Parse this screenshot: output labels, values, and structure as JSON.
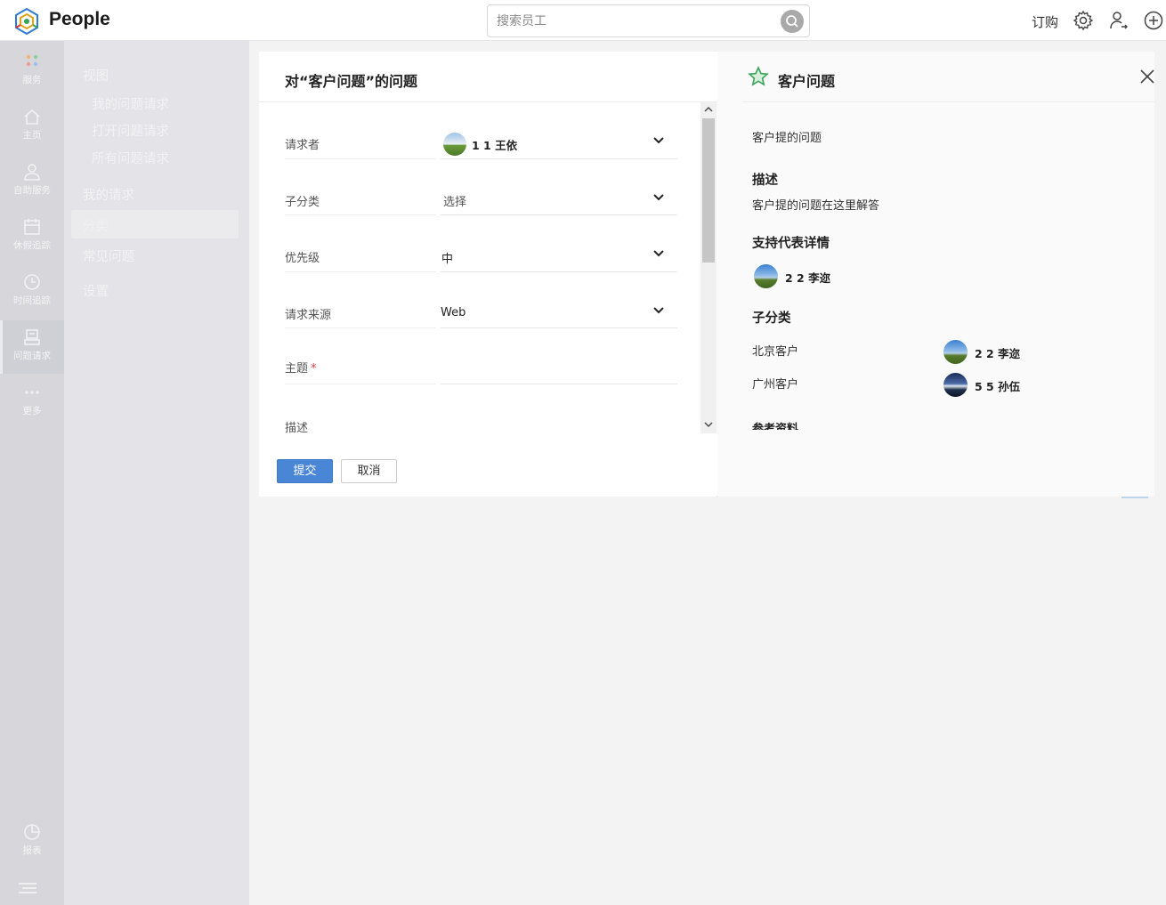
{
  "app": {
    "name": "People"
  },
  "search": {
    "placeholder": "搜索员工"
  },
  "topbar": {
    "subscribe": "订购"
  },
  "rail": {
    "items": [
      {
        "label": "服务",
        "icon": "services-dots-icon"
      },
      {
        "label": "主页",
        "icon": "home-icon"
      },
      {
        "label": "自助服务",
        "icon": "user-icon"
      },
      {
        "label": "休假追踪",
        "icon": "calendar-icon"
      },
      {
        "label": "时间追踪",
        "icon": "clock-icon"
      },
      {
        "label": "问题请求",
        "icon": "ticket-icon",
        "active": true
      },
      {
        "label": "更多",
        "icon": "more-dots-icon"
      },
      {
        "label": "报表",
        "icon": "pie-chart-icon"
      }
    ]
  },
  "subnav": {
    "view": "视图",
    "my_requests_issue": "我的问题请求",
    "open_requests": "打开问题请求",
    "all_requests": "所有问题请求",
    "my_requests": "我的请求",
    "category": "分类",
    "faq": "常见问题",
    "settings": "设置"
  },
  "form": {
    "title": "对“客户问题”的问题",
    "fields": {
      "requester": {
        "label": "请求者",
        "value": "1 1 王依"
      },
      "subcategory": {
        "label": "子分类",
        "value": "选择"
      },
      "priority": {
        "label": "优先级",
        "value": "中"
      },
      "source": {
        "label": "请求来源",
        "value": "Web"
      },
      "subject": {
        "label": "主题",
        "required": "*",
        "value": ""
      },
      "description": {
        "label": "描述"
      }
    },
    "submit": "提交",
    "cancel": "取消"
  },
  "panel": {
    "title": "客户问题",
    "summary": "客户提的问题",
    "desc_head": "描述",
    "desc_text": "客户提的问题在这里解答",
    "agent_head": "支持代表详情",
    "agent_name": "2 2 李迩",
    "subcat_head": "子分类",
    "subcats": [
      {
        "name": "北京客户",
        "agent": "2 2 李迩"
      },
      {
        "name": "广州客户",
        "agent": "5 5 孙伍"
      }
    ],
    "reference_head": "参考资料"
  },
  "colors": {
    "accent": "#4a86d6",
    "star": "#3aa35a",
    "required": "#e23b3b"
  }
}
